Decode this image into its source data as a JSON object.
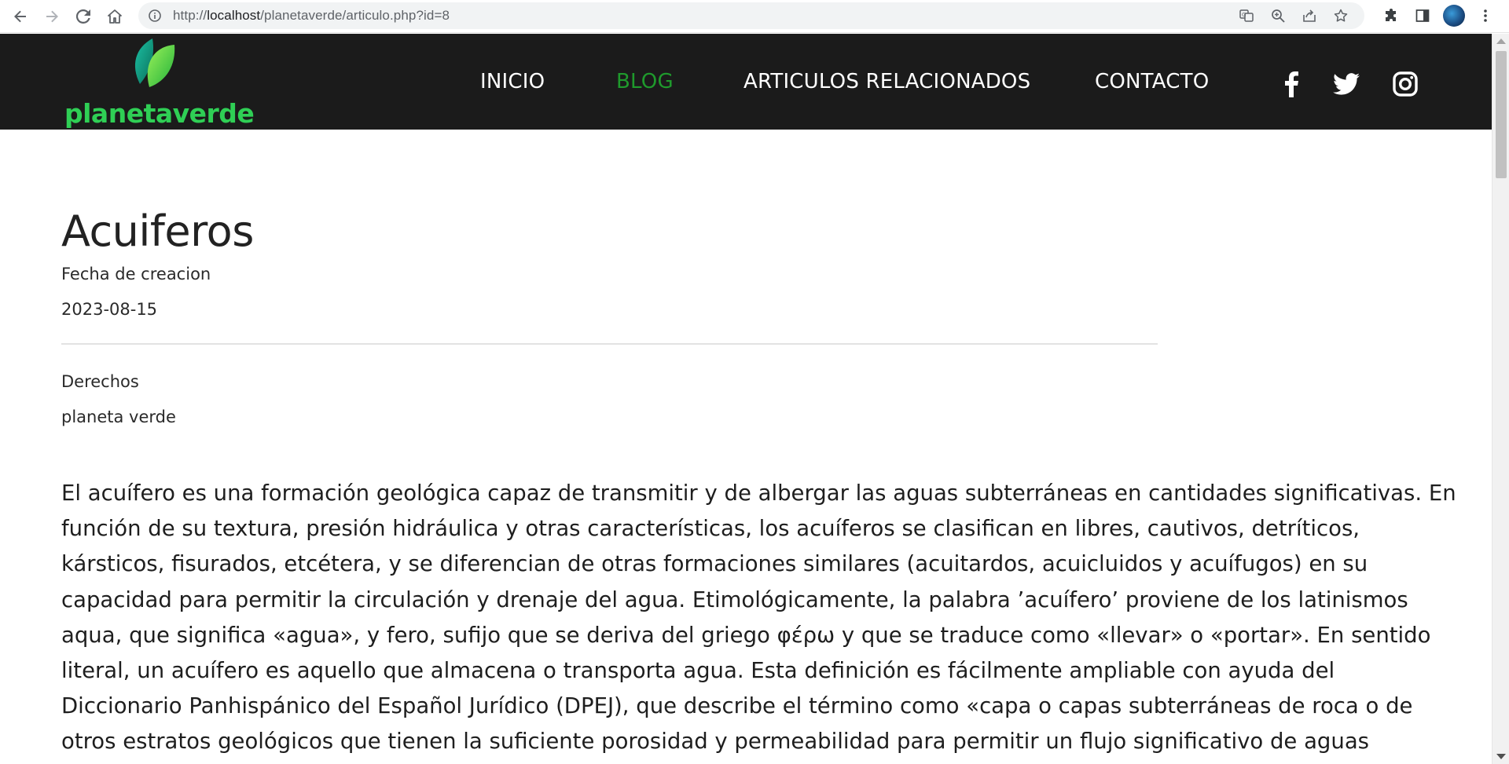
{
  "browser": {
    "url_prefix": "http://",
    "url_host": "localhost",
    "url_path": "/planetaverde/articulo.php?id=8"
  },
  "site": {
    "logo_text": "planetaverde",
    "nav": [
      {
        "label": "INICIO",
        "active": false
      },
      {
        "label": "BLOG",
        "active": true
      },
      {
        "label": "ARTICULOS RELACIONADOS",
        "active": false
      },
      {
        "label": "CONTACTO",
        "active": false
      }
    ],
    "social_icons": [
      "facebook-icon",
      "twitter-icon",
      "instagram-icon"
    ],
    "colors": {
      "header_bg": "#1b1b1b",
      "active_nav": "#1f9a2c",
      "logo_green": "#2fcf55"
    }
  },
  "article": {
    "title": "Acuiferos",
    "date_label": "Fecha de creacion",
    "date_value": "2023-08-15",
    "rights_label": "Derechos",
    "rights_value": "planeta verde",
    "body": "El acuífero es una formación geológica capaz de transmitir y de albergar las aguas subterráneas en cantidades significativas. En función de su textura, presión hidráulica y otras características, los acuíferos se clasifican en libres, cautivos, detríticos, kársticos, fisurados, etcétera, y se diferencian de otras formaciones similares (acuitardos, acuicluidos y acuífugos) en su capacidad para permitir la circulación y drenaje del agua. Etimológicamente, la palabra ’acuífero’ proviene de los latinismos aqua, que significa «agua», y fero, sufijo que se deriva del griego φέρω y que se traduce como «llevar» o «portar». En sentido literal, un acuífero es aquello que almacena o transporta agua. Esta definición es fácilmente ampliable con ayuda del Diccionario Panhispánico del Español Jurídico (DPEJ), que describe el término como «capa o capas subterráneas de roca o de otros estratos geológicos que tienen la suficiente porosidad y permeabilidad para permitir un flujo significativo de aguas"
  }
}
